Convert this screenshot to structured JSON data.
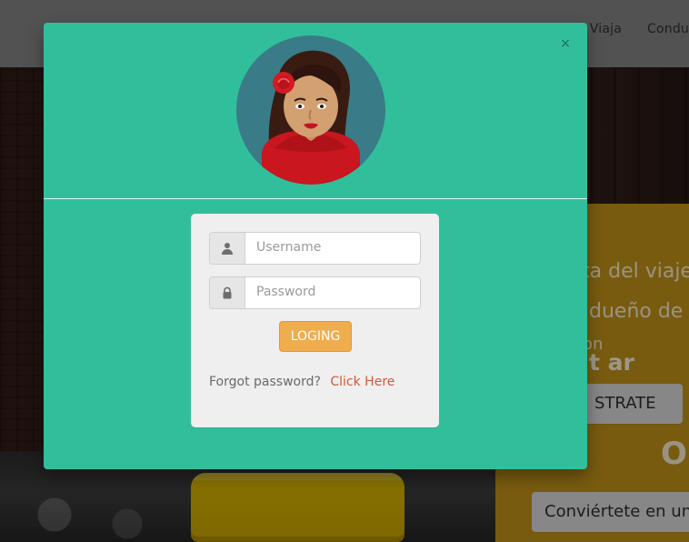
{
  "background": {
    "nav": {
      "items": [
        "Viaja",
        "Condu"
      ]
    },
    "right_panel": {
      "line1": "ta del viaje",
      "line2": "dueño de t",
      "line3": "on",
      "line4": "t ar",
      "register_button_label": "STRATE",
      "big_o": "O",
      "convertete_button_label": "Conviértete en un c"
    }
  },
  "modal": {
    "close_label": "×",
    "username_placeholder": "Username",
    "password_placeholder": "Password",
    "login_button_label": "LOGING",
    "forgot_text": "Forgot password?",
    "click_here_label": "Click Here"
  },
  "icons": {
    "user": "user-icon",
    "lock": "lock-icon",
    "avatar": "avatar-icon"
  },
  "colors": {
    "modal_bg": "#31bf9b",
    "button_bg": "#f0ad4e",
    "link": "#d2573b",
    "card_bg": "#efefef"
  }
}
